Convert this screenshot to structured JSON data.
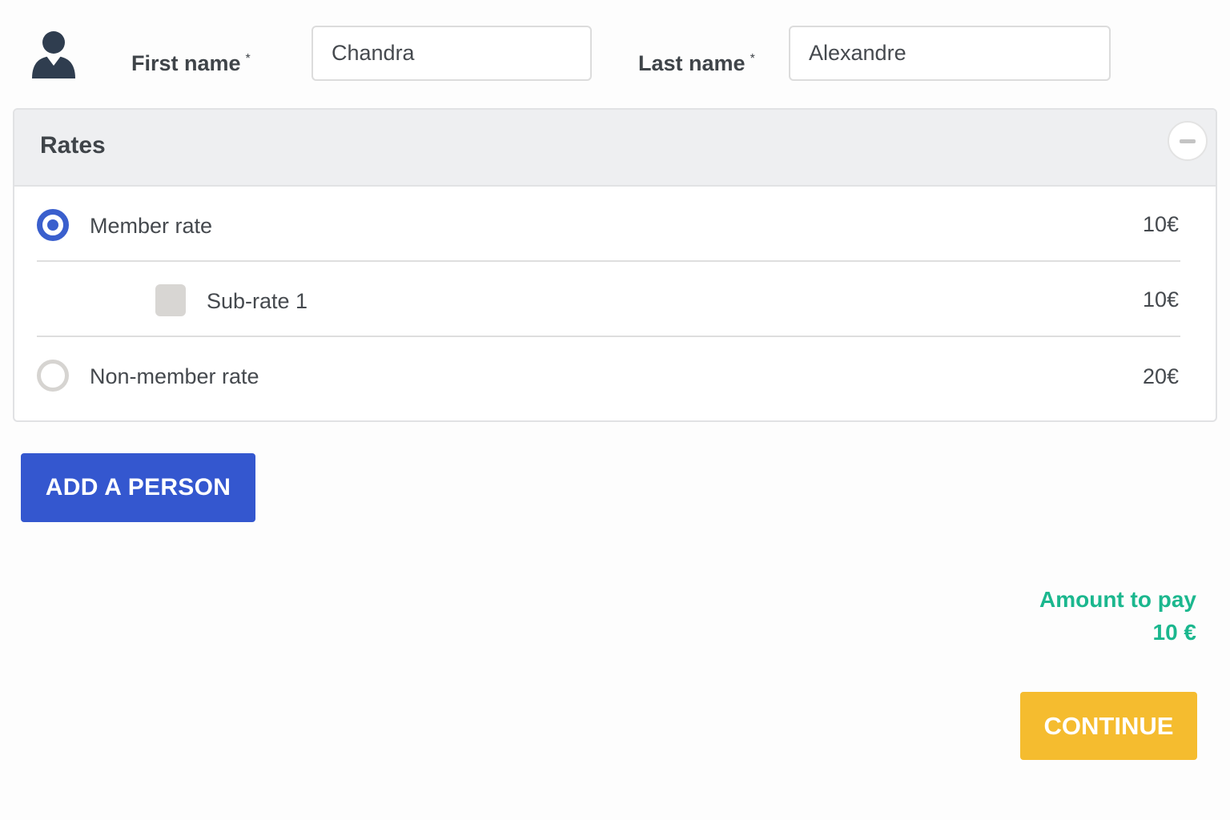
{
  "person": {
    "avatar_icon": "user-avatar-icon",
    "first_name_label": "First name",
    "first_name_required": "*",
    "first_name_value": "Chandra",
    "last_name_label": "Last name",
    "last_name_required": "*",
    "last_name_value": "Alexandre"
  },
  "rates": {
    "title": "Rates",
    "collapse_icon": "minus-icon",
    "items": [
      {
        "label": "Member rate",
        "price": "10€",
        "selected": true
      },
      {
        "label": "Sub-rate 1",
        "price": "10€",
        "checked": false
      },
      {
        "label": "Non-member rate",
        "price": "20€",
        "selected": false
      }
    ]
  },
  "actions": {
    "add_person_label": "ADD A PERSON",
    "continue_label": "CONTINUE"
  },
  "summary": {
    "amount_label": "Amount to pay",
    "amount_value": "10 €"
  },
  "colors": {
    "primary_blue": "#3457cf",
    "radio_blue": "#3a5fcd",
    "continue_yellow": "#f5bc2f",
    "amount_green": "#1bb78e",
    "header_gray": "#eeeff1"
  }
}
